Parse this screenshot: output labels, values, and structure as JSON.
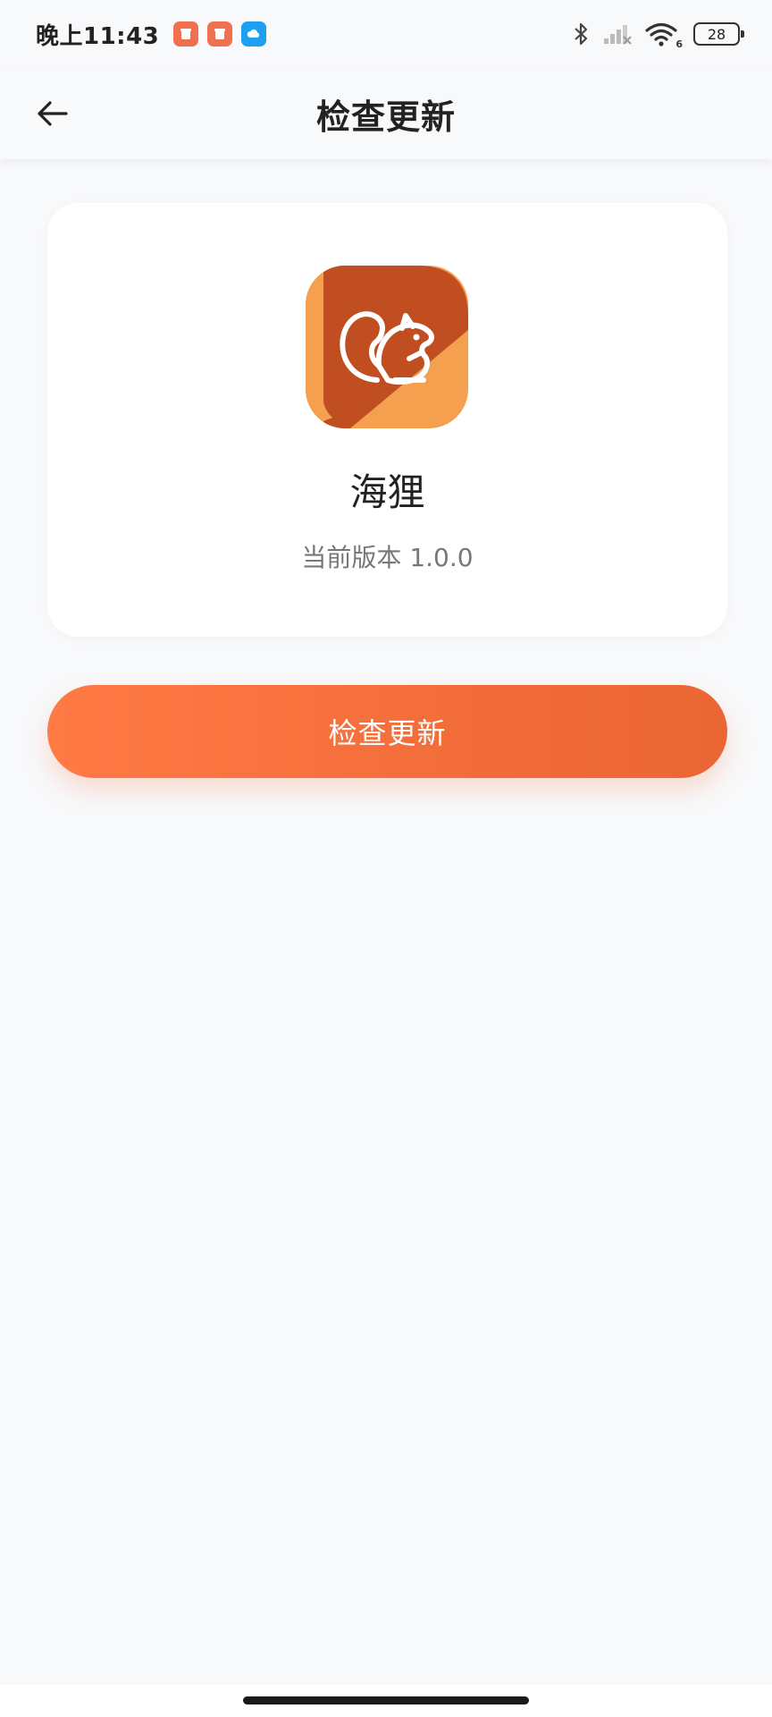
{
  "status_bar": {
    "time": "晚上11:43",
    "notification_icons": [
      "red-app-icon",
      "red-app-icon",
      "blue-cloud-icon"
    ],
    "battery_level": "28",
    "icons": [
      "bluetooth-icon",
      "cellular-signal-icon",
      "wifi-icon",
      "battery-icon"
    ],
    "wifi_badge": "6"
  },
  "nav": {
    "title": "检查更新",
    "back_icon": "arrow-left-icon"
  },
  "app_card": {
    "icon": "squirrel-app-icon",
    "name": "海狸",
    "version_label": "当前版本 1.0.0"
  },
  "actions": {
    "check_update_label": "检查更新"
  },
  "colors": {
    "accent": "#f36d3a",
    "accent_light": "#ff7a45",
    "icon_orange": "#f4a04e",
    "icon_dark": "#c04e20",
    "notif_red": "#f0704f",
    "notif_blue": "#1ea0f0",
    "background": "#f8f9fb"
  }
}
